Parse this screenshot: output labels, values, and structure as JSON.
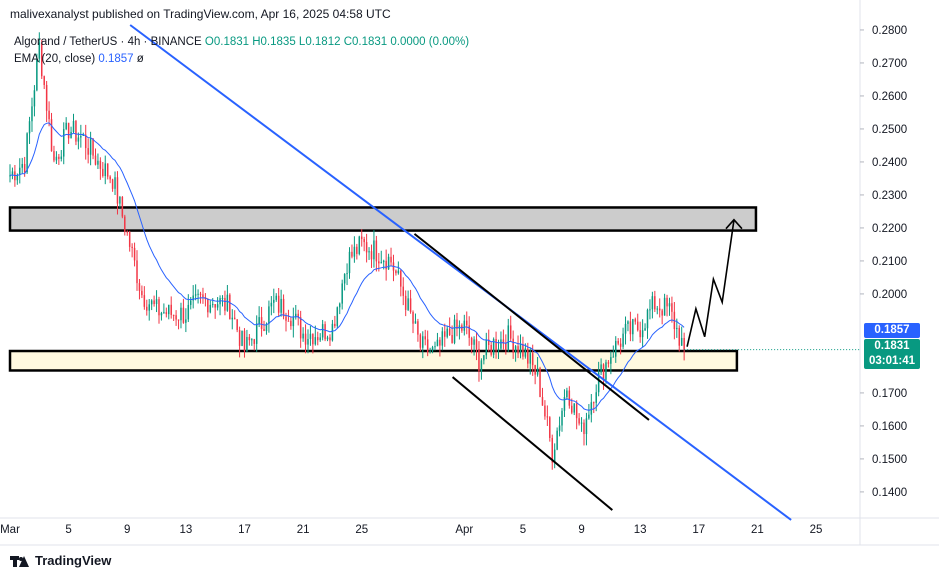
{
  "header": {
    "published": "malivexanalyst published on TradingView.com, Apr 16, 2025 04:58 UTC"
  },
  "legend": {
    "symbol": "Algorand / TetherUS · 4h · BINANCE",
    "open": "O0.1831",
    "high": "H0.1835",
    "low": "L0.1812",
    "close": "C0.1831",
    "change": "0.0000 (0.00%)",
    "ema_label": "EMA (20, close)",
    "ema_value": "0.1857",
    "ema_symbol": "ø"
  },
  "price_badges": {
    "ema": "0.1857",
    "last_price": "0.1831",
    "countdown": "03:01:41"
  },
  "footer": {
    "brand": "TradingView"
  },
  "colors": {
    "up": "#089981",
    "down": "#f23645",
    "ema": "#2962ff",
    "trendline": "#2962ff",
    "support_zone": "#fff9e0",
    "resistance_zone": "#cccccc"
  },
  "chart_data": {
    "type": "candlestick",
    "ylim": [
      0.133,
      0.2815
    ],
    "xlim": [
      0,
      58
    ],
    "x_tick_labels": [
      {
        "x": 0,
        "label": "Mar"
      },
      {
        "x": 4,
        "label": "5"
      },
      {
        "x": 8,
        "label": "9"
      },
      {
        "x": 12,
        "label": "13"
      },
      {
        "x": 16,
        "label": "17"
      },
      {
        "x": 20,
        "label": "21"
      },
      {
        "x": 24,
        "label": "25"
      },
      {
        "x": 31,
        "label": "Apr"
      },
      {
        "x": 35,
        "label": "5"
      },
      {
        "x": 39,
        "label": "9"
      },
      {
        "x": 43,
        "label": "13"
      },
      {
        "x": 47,
        "label": "17"
      },
      {
        "x": 51,
        "label": "21"
      },
      {
        "x": 55,
        "label": "25"
      }
    ],
    "y_ticks": [
      "0.1400",
      "0.1500",
      "0.1600",
      "0.1700",
      "0.2000",
      "0.2100",
      "0.2200",
      "0.2300",
      "0.2400",
      "0.2500",
      "0.2600",
      "0.2700",
      "0.2800"
    ],
    "close_anchors": [
      [
        0,
        0.236
      ],
      [
        1,
        0.24
      ],
      [
        2,
        0.275
      ],
      [
        3,
        0.24
      ],
      [
        4,
        0.25
      ],
      [
        5,
        0.247
      ],
      [
        6,
        0.24
      ],
      [
        7,
        0.235
      ],
      [
        8,
        0.218
      ],
      [
        9,
        0.2
      ],
      [
        10,
        0.195
      ],
      [
        11,
        0.194
      ],
      [
        12,
        0.194
      ],
      [
        13,
        0.198
      ],
      [
        14,
        0.198
      ],
      [
        15,
        0.196
      ],
      [
        16,
        0.183
      ],
      [
        17,
        0.19
      ],
      [
        18,
        0.197
      ],
      [
        19,
        0.195
      ],
      [
        20,
        0.188
      ],
      [
        21,
        0.188
      ],
      [
        22,
        0.19
      ],
      [
        23,
        0.21
      ],
      [
        24,
        0.215
      ],
      [
        25,
        0.213
      ],
      [
        26,
        0.21
      ],
      [
        27,
        0.198
      ],
      [
        28,
        0.184
      ],
      [
        29,
        0.182
      ],
      [
        30,
        0.188
      ],
      [
        31,
        0.19
      ],
      [
        32,
        0.18
      ],
      [
        33,
        0.185
      ],
      [
        34,
        0.187
      ],
      [
        35,
        0.183
      ],
      [
        36,
        0.175
      ],
      [
        37,
        0.152
      ],
      [
        38,
        0.172
      ],
      [
        39,
        0.158
      ],
      [
        40,
        0.173
      ],
      [
        41,
        0.182
      ],
      [
        42,
        0.188
      ],
      [
        43,
        0.19
      ],
      [
        44,
        0.197
      ],
      [
        45,
        0.195
      ],
      [
        46,
        0.1831
      ]
    ],
    "zones": [
      {
        "name": "resistance",
        "x0": 0,
        "x1": 50.9,
        "y0": 0.2192,
        "y1": 0.2262
      },
      {
        "name": "support",
        "x0": 0,
        "x1": 49.6,
        "y0": 0.1768,
        "y1": 0.1827
      }
    ],
    "trendlines": [
      {
        "name": "blue-descending",
        "points": [
          [
            8.2,
            0.2815
          ],
          [
            53.3,
            0.1315
          ]
        ]
      },
      {
        "name": "wedge-upper",
        "points": [
          [
            27.6,
            0.2182
          ],
          [
            43.6,
            0.1618
          ]
        ]
      },
      {
        "name": "wedge-lower",
        "points": [
          [
            30.2,
            0.1748
          ],
          [
            41.1,
            0.1345
          ]
        ]
      }
    ],
    "projection": [
      [
        46.2,
        0.184
      ],
      [
        46.8,
        0.1955
      ],
      [
        47.4,
        0.187
      ],
      [
        48,
        0.2045
      ],
      [
        48.6,
        0.1975
      ],
      [
        49.4,
        0.2225
      ]
    ]
  }
}
